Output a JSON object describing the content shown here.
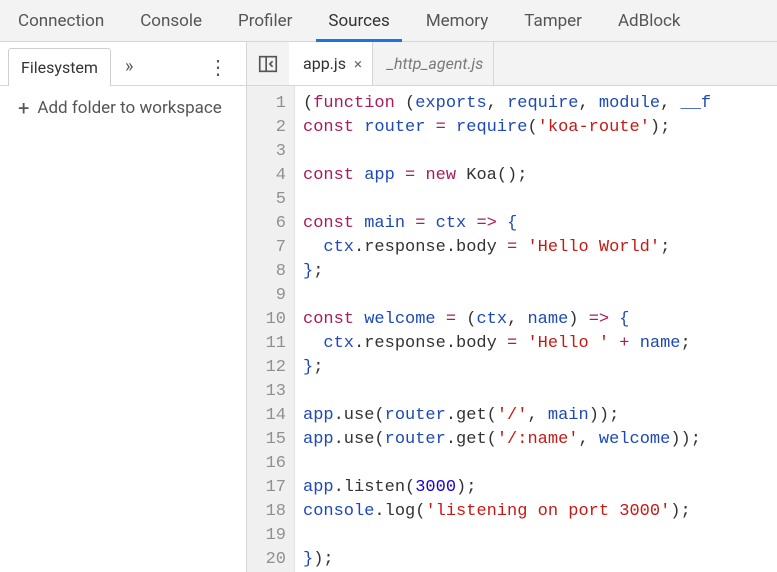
{
  "panel_tabs": {
    "items": [
      "Connection",
      "Console",
      "Profiler",
      "Sources",
      "Memory",
      "Tamper",
      "AdBlock"
    ],
    "active_index": 3
  },
  "sidebar": {
    "tab_label": "Filesystem",
    "overflow_glyph": "»",
    "kebab_glyph": "⋮",
    "add_folder_label": "Add folder to workspace",
    "plus_glyph": "+"
  },
  "editor_tabs": {
    "items": [
      {
        "name": "app.js",
        "active": true,
        "closeable": true,
        "italic": false
      },
      {
        "name": "_http_agent.js",
        "active": false,
        "closeable": false,
        "italic": true
      }
    ],
    "close_glyph": "×"
  },
  "code": {
    "line_count": 20,
    "lines": [
      [
        [
          "punc",
          "("
        ],
        [
          "kw",
          "function"
        ],
        [
          "punc",
          " ("
        ],
        [
          "var",
          "exports"
        ],
        [
          "punc",
          ", "
        ],
        [
          "var",
          "require"
        ],
        [
          "punc",
          ", "
        ],
        [
          "var",
          "module"
        ],
        [
          "punc",
          ", "
        ],
        [
          "var",
          "__f"
        ]
      ],
      [
        [
          "kw",
          "const"
        ],
        [
          "punc",
          " "
        ],
        [
          "def",
          "router"
        ],
        [
          "punc",
          " "
        ],
        [
          "op",
          "="
        ],
        [
          "punc",
          " "
        ],
        [
          "var",
          "require"
        ],
        [
          "punc",
          "("
        ],
        [
          "str",
          "'koa-route'"
        ],
        [
          "punc",
          ");"
        ]
      ],
      [],
      [
        [
          "kw",
          "const"
        ],
        [
          "punc",
          " "
        ],
        [
          "def",
          "app"
        ],
        [
          "punc",
          " "
        ],
        [
          "op",
          "="
        ],
        [
          "punc",
          " "
        ],
        [
          "kw",
          "new"
        ],
        [
          "punc",
          " Koa();"
        ]
      ],
      [],
      [
        [
          "kw",
          "const"
        ],
        [
          "punc",
          " "
        ],
        [
          "def",
          "main"
        ],
        [
          "punc",
          " "
        ],
        [
          "op",
          "="
        ],
        [
          "punc",
          " "
        ],
        [
          "var",
          "ctx"
        ],
        [
          "punc",
          " "
        ],
        [
          "op",
          "=>"
        ],
        [
          "punc",
          " "
        ],
        [
          "brace",
          "{"
        ]
      ],
      [
        [
          "punc",
          "  "
        ],
        [
          "var",
          "ctx"
        ],
        [
          "punc",
          ".response.body "
        ],
        [
          "op",
          "="
        ],
        [
          "punc",
          " "
        ],
        [
          "str",
          "'Hello World'"
        ],
        [
          "punc",
          ";"
        ]
      ],
      [
        [
          "brace",
          "}"
        ],
        [
          "punc",
          ";"
        ]
      ],
      [],
      [
        [
          "kw",
          "const"
        ],
        [
          "punc",
          " "
        ],
        [
          "def",
          "welcome"
        ],
        [
          "punc",
          " "
        ],
        [
          "op",
          "="
        ],
        [
          "punc",
          " ("
        ],
        [
          "var",
          "ctx"
        ],
        [
          "punc",
          ", "
        ],
        [
          "var",
          "name"
        ],
        [
          "punc",
          ") "
        ],
        [
          "op",
          "=>"
        ],
        [
          "punc",
          " "
        ],
        [
          "brace",
          "{"
        ]
      ],
      [
        [
          "punc",
          "  "
        ],
        [
          "var",
          "ctx"
        ],
        [
          "punc",
          ".response.body "
        ],
        [
          "op",
          "="
        ],
        [
          "punc",
          " "
        ],
        [
          "str",
          "'Hello '"
        ],
        [
          "punc",
          " "
        ],
        [
          "op",
          "+"
        ],
        [
          "punc",
          " "
        ],
        [
          "var",
          "name"
        ],
        [
          "punc",
          ";"
        ]
      ],
      [
        [
          "brace",
          "}"
        ],
        [
          "punc",
          ";"
        ]
      ],
      [],
      [
        [
          "var",
          "app"
        ],
        [
          "punc",
          ".use("
        ],
        [
          "var",
          "router"
        ],
        [
          "punc",
          ".get("
        ],
        [
          "str",
          "'/'"
        ],
        [
          "punc",
          ", "
        ],
        [
          "var",
          "main"
        ],
        [
          "punc",
          "));"
        ]
      ],
      [
        [
          "var",
          "app"
        ],
        [
          "punc",
          ".use("
        ],
        [
          "var",
          "router"
        ],
        [
          "punc",
          ".get("
        ],
        [
          "str",
          "'/:name'"
        ],
        [
          "punc",
          ", "
        ],
        [
          "var",
          "welcome"
        ],
        [
          "punc",
          "));"
        ]
      ],
      [],
      [
        [
          "var",
          "app"
        ],
        [
          "punc",
          ".listen("
        ],
        [
          "num",
          "3000"
        ],
        [
          "punc",
          ");"
        ]
      ],
      [
        [
          "var",
          "console"
        ],
        [
          "punc",
          ".log("
        ],
        [
          "str",
          "'listening on port 3000'"
        ],
        [
          "punc",
          ");"
        ]
      ],
      [],
      [
        [
          "brace",
          "}"
        ],
        [
          "punc",
          ");"
        ]
      ]
    ]
  }
}
